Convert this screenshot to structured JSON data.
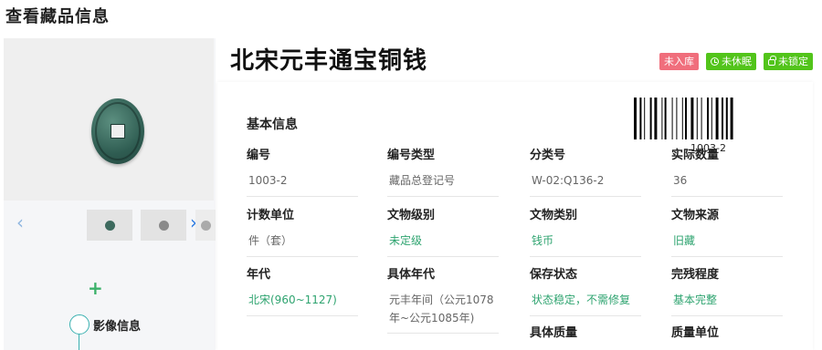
{
  "page_title": "查看藏品信息",
  "item": {
    "name": "北宋元丰通宝铜钱",
    "badges": [
      {
        "label": "未入库",
        "color": "#f06e7c",
        "icon": ""
      },
      {
        "label": "未休眠",
        "color": "#52c41a",
        "icon": "clock-icon"
      },
      {
        "label": "未锁定",
        "color": "#52c41a",
        "icon": "lock-icon"
      }
    ],
    "barcode_text": "1003-2"
  },
  "gallery": {
    "prev_icon": "‹",
    "next_icon": "›"
  },
  "sidebar": {
    "add_icon": "+",
    "timeline_label": "影像信息"
  },
  "basic_info": {
    "title": "基本信息",
    "fields": [
      {
        "label": "编号",
        "value": "1003-2"
      },
      {
        "label": "编号类型",
        "value": "藏品总登记号"
      },
      {
        "label": "分类号",
        "value": "W-02:Q136-2"
      },
      {
        "label": "实际数量",
        "value": "36"
      },
      {
        "label": "计数单位",
        "value": "件（套）"
      },
      {
        "label": "文物级别",
        "value": "未定级"
      },
      {
        "label": "文物类别",
        "value": "钱币"
      },
      {
        "label": "文物来源",
        "value": "旧藏"
      },
      {
        "label": "年代",
        "value": "北宋(960~1127)"
      },
      {
        "label": "具体年代",
        "value": "元丰年间（公元1078年~公元1085年)"
      },
      {
        "label": "保存状态",
        "value": "状态稳定，不需修复"
      },
      {
        "label": "完残程度",
        "value": "基本完整"
      },
      {
        "label": "具体质量",
        "value": ""
      },
      {
        "label": "质量单位",
        "value": ""
      }
    ]
  },
  "colors": {
    "accent_green": "#2fa470",
    "badge_red": "#f06e7c",
    "badge_green": "#52c41a",
    "link_blue": "#2a7ae2"
  }
}
